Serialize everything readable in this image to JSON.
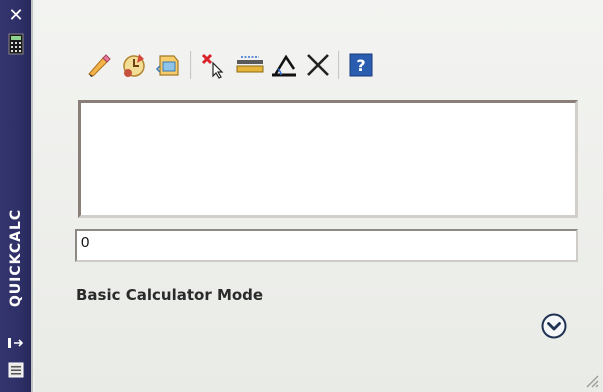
{
  "sidebar": {
    "close_glyph": "✕",
    "title": "QUICKCALC",
    "icons": [
      "close-icon",
      "calculator-icon",
      "auto-hide-icon",
      "properties-icon"
    ]
  },
  "toolbar": {
    "buttons": [
      {
        "icon": "clear-eraser-icon",
        "tooltip": ""
      },
      {
        "icon": "clear-history-icon",
        "tooltip": ""
      },
      {
        "icon": "paste-value-to-command-line-icon",
        "tooltip": ""
      },
      {
        "icon": "get-coordinates-icon",
        "tooltip": ""
      },
      {
        "icon": "distance-between-two-points-icon",
        "tooltip": ""
      },
      {
        "icon": "angle-of-line-icon",
        "tooltip": ""
      },
      {
        "icon": "intersection-of-two-lines-icon",
        "tooltip": ""
      },
      {
        "icon": "help-icon",
        "tooltip": ""
      }
    ],
    "help_glyph": "?"
  },
  "calculator": {
    "history_lines": [],
    "input_value": "0",
    "mode_label": "Basic Calculator Mode"
  },
  "colors": {
    "sidebar": "#2f3068",
    "panel": "#eef0ec",
    "help_blue": "#2a5db0"
  }
}
